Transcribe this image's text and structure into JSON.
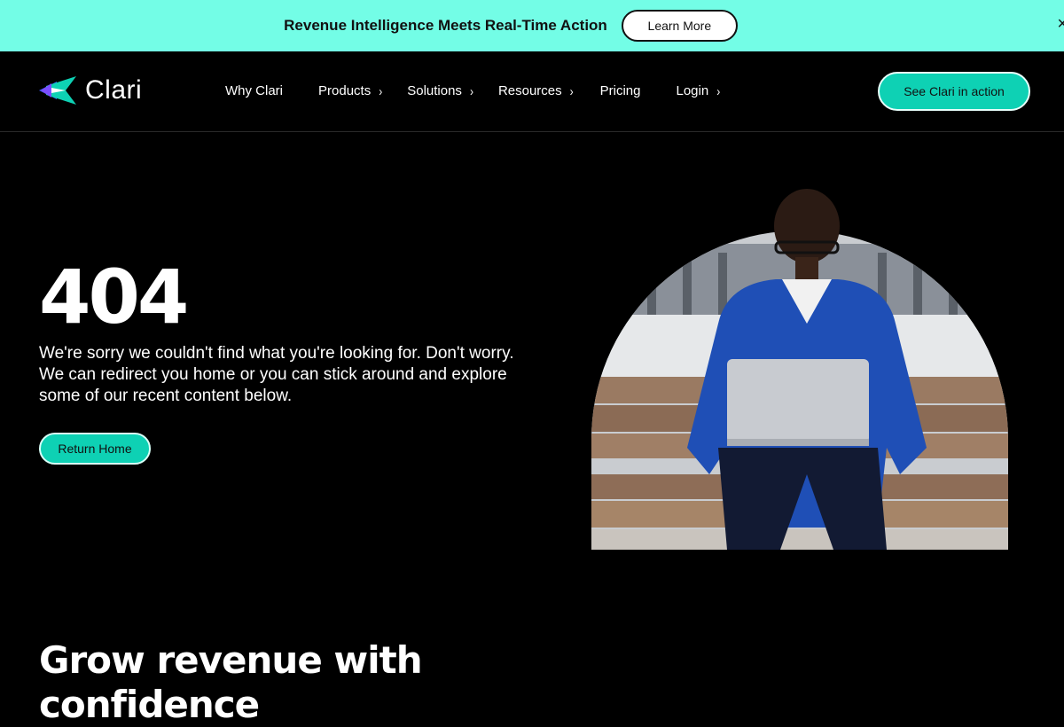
{
  "announcement": {
    "text": "Revenue Intelligence Meets Real-Time Action",
    "button": "Learn More",
    "close": "×"
  },
  "brand": {
    "name": "Clari"
  },
  "nav": {
    "items": [
      {
        "label": "Why Clari",
        "has_submenu": false
      },
      {
        "label": "Products",
        "has_submenu": true
      },
      {
        "label": "Solutions",
        "has_submenu": true
      },
      {
        "label": "Resources",
        "has_submenu": true
      },
      {
        "label": "Pricing",
        "has_submenu": false
      },
      {
        "label": "Login",
        "has_submenu": true
      }
    ],
    "chevron": "›",
    "cta": "See Clari in action"
  },
  "hero": {
    "code": "404",
    "message": "We're sorry we couldn't find what you're looking for. Don't worry. We can redirect you home or you can stick around and explore some of our recent content below.",
    "button": "Return Home",
    "image_icon": "man-with-laptop-photo"
  },
  "section": {
    "heading": "Grow revenue with confidence"
  },
  "colors": {
    "announce_bg": "#73fde6",
    "accent": "#0ed1b4",
    "background": "#000000"
  }
}
